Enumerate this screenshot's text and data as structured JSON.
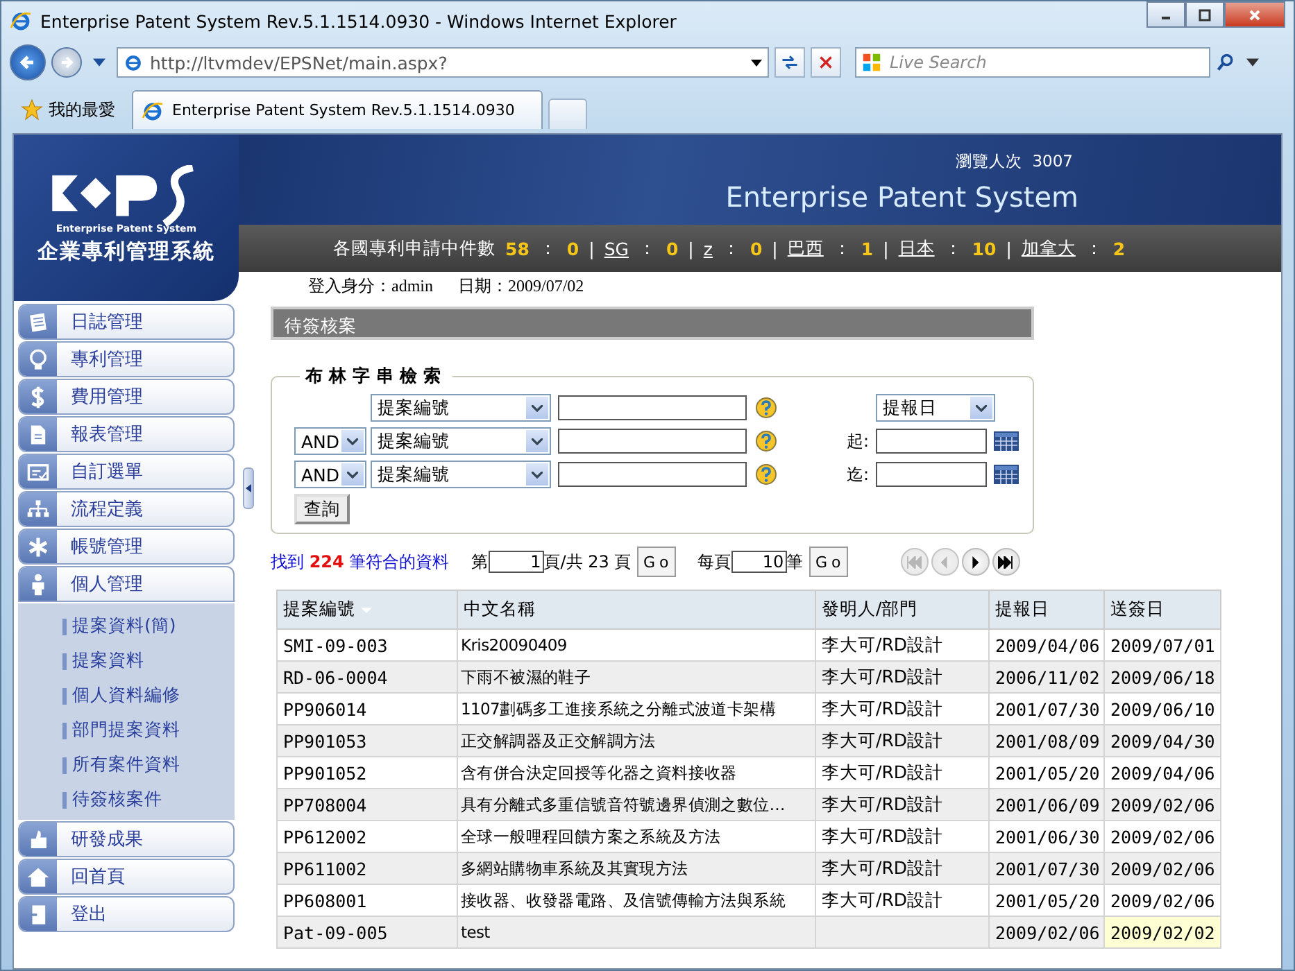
{
  "browser": {
    "title": "Enterprise Patent System Rev.5.1.1514.0930 - Windows Internet Explorer",
    "address": "http://ltvmdev/EPSNet/main.aspx?",
    "search_placeholder": "Live Search",
    "favorites": "我的最愛",
    "tab": "Enterprise Patent System Rev.5.1.1514.0930"
  },
  "header": {
    "logo_subtitle": "Enterprise Patent System",
    "logo_name": "企業專利管理系統",
    "visits_label": "瀏覽人次",
    "visits": "3007",
    "system_title": "Enterprise Patent System",
    "summary": {
      "label": "各國專利申請中件數",
      "total": "58",
      "colon": "：",
      "count": "0"
    },
    "countries": [
      {
        "separator": "|",
        "name": "SG",
        "colon": "：",
        "count": "0"
      },
      {
        "separator": "|",
        "name": "z",
        "colon": "：",
        "count": "0"
      },
      {
        "separator": "|",
        "name": "巴西",
        "colon": "：",
        "count": "1"
      },
      {
        "separator": "|",
        "name": "日本",
        "colon": "：",
        "count": "10"
      },
      {
        "separator": "|",
        "name": "加拿大",
        "colon": "：",
        "count": "2"
      }
    ],
    "login": {
      "label": "登入身分：",
      "user": "admin",
      "date_label": "日期：",
      "date": "2009/07/02"
    }
  },
  "sidebar": {
    "items": [
      {
        "label": "日誌管理",
        "kind": "journal",
        "expanded": false
      },
      {
        "label": "專利管理",
        "kind": "bulb",
        "expanded": false
      },
      {
        "label": "費用管理",
        "kind": "dollar",
        "expanded": false
      },
      {
        "label": "報表管理",
        "kind": "report",
        "expanded": false
      },
      {
        "label": "自訂選單",
        "kind": "form",
        "expanded": false
      },
      {
        "label": "流程定義",
        "kind": "flow",
        "expanded": false
      },
      {
        "label": "帳號管理",
        "kind": "star",
        "expanded": false
      },
      {
        "label": "個人管理",
        "kind": "person",
        "expanded": true,
        "children": [
          {
            "label": "提案資料(簡)"
          },
          {
            "label": "提案資料"
          },
          {
            "label": "個人資料編修"
          },
          {
            "label": "部門提案資料"
          },
          {
            "label": "所有案件資料"
          },
          {
            "label": "待簽核案件"
          }
        ]
      },
      {
        "label": "研發成果",
        "kind": "thumb",
        "expanded": false
      },
      {
        "label": "回首頁",
        "kind": "home",
        "expanded": false
      },
      {
        "label": "登出",
        "kind": "exit",
        "expanded": false
      }
    ]
  },
  "panel_title": "待簽核案",
  "search": {
    "legend": "布林字串檢索",
    "rows": [
      {
        "field": "提案編號"
      },
      {
        "operator": "AND",
        "field": "提案編號"
      },
      {
        "operator": "AND",
        "field": "提案編號"
      }
    ],
    "date_field": "提報日",
    "from_label": "起:",
    "to_label": "迄:",
    "button": "查詢"
  },
  "pager": {
    "found_prefix": "找到",
    "found_count": "224",
    "found_suffix": "筆符合的資料",
    "page_prefix": "第",
    "page": "1",
    "page_suffix": "頁/共 23 頁",
    "go": "Go",
    "per_prefix": "每頁",
    "per_page": "10",
    "per_suffix": "筆",
    "go2": "Go",
    "nav": [
      {
        "kind": "first",
        "disabled": true
      },
      {
        "kind": "prev",
        "disabled": true
      },
      {
        "kind": "next",
        "disabled": false
      },
      {
        "kind": "last",
        "disabled": false
      }
    ]
  },
  "table": {
    "columns": [
      "提案編號",
      "中文名稱",
      "發明人/部門",
      "提報日",
      "送簽日"
    ],
    "rows": [
      {
        "cells": [
          "SMI-09-003",
          "Kris20090409",
          "李大可/RD設計",
          "2009/04/06",
          "2009/07/01"
        ],
        "highlighted": false
      },
      {
        "cells": [
          "RD-06-0004",
          "下雨不被濕的鞋子",
          "李大可/RD設計",
          "2006/11/02",
          "2009/06/18"
        ],
        "highlighted": false
      },
      {
        "cells": [
          "PP906014",
          "1107劃碼多工進接系統之分離式波道卡架構",
          "李大可/RD設計",
          "2001/07/30",
          "2009/06/10"
        ],
        "highlighted": false
      },
      {
        "cells": [
          "PP901053",
          "正交解調器及正交解調方法",
          "李大可/RD設計",
          "2001/08/09",
          "2009/04/30"
        ],
        "highlighted": false
      },
      {
        "cells": [
          "PP901052",
          "含有併合決定回授等化器之資料接收器",
          "李大可/RD設計",
          "2001/05/20",
          "2009/04/06"
        ],
        "highlighted": false
      },
      {
        "cells": [
          "PP708004",
          "具有分離式多重信號音符號邊界偵測之數位…",
          "李大可/RD設計",
          "2001/06/09",
          "2009/02/06"
        ],
        "highlighted": false
      },
      {
        "cells": [
          "PP612002",
          "全球一般哩程回饋方案之系統及方法",
          "李大可/RD設計",
          "2001/06/30",
          "2009/02/06"
        ],
        "highlighted": false
      },
      {
        "cells": [
          "PP611002",
          "多網站購物車系統及其實現方法",
          "李大可/RD設計",
          "2001/07/30",
          "2009/02/06"
        ],
        "highlighted": false
      },
      {
        "cells": [
          "PP608001",
          "接收器、收發器電路、及信號傳輸方法與系統",
          "李大可/RD設計",
          "2001/05/20",
          "2009/02/06"
        ],
        "highlighted": false
      },
      {
        "cells": [
          "Pat-09-005",
          "test",
          "",
          "2009/02/06",
          "2009/02/02"
        ],
        "highlighted": true
      }
    ]
  }
}
